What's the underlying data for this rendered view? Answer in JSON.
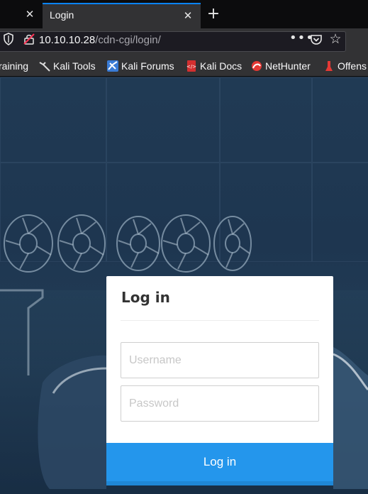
{
  "browser": {
    "active_tab_title": "Login",
    "url_host": "10.10.10.28",
    "url_path": "/cdn-cgi/login/",
    "bookmarks": [
      {
        "label": "raining",
        "icon": "kali-training-icon"
      },
      {
        "label": "Kali Tools",
        "icon": "kali-tools-icon"
      },
      {
        "label": "Kali Forums",
        "icon": "kali-forums-icon"
      },
      {
        "label": "Kali Docs",
        "icon": "kali-docs-icon"
      },
      {
        "label": "NetHunter",
        "icon": "nethunter-icon"
      },
      {
        "label": "Offens",
        "icon": "offensive-security-icon"
      }
    ]
  },
  "login": {
    "title": "Log in",
    "username_placeholder": "Username",
    "password_placeholder": "Password",
    "submit_label": "Log in"
  },
  "colors": {
    "accent": "#2496ec",
    "tab_highlight": "#0a84ff"
  }
}
